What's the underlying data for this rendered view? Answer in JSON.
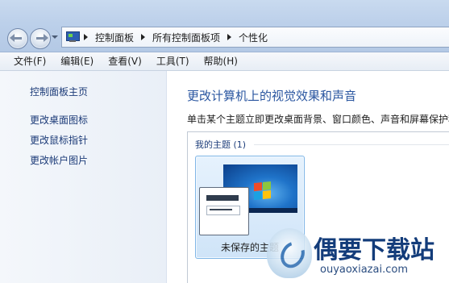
{
  "address": {
    "crumbs": [
      "控制面板",
      "所有控制面板项",
      "个性化"
    ]
  },
  "menu": {
    "items": [
      "文件(F)",
      "编辑(E)",
      "查看(V)",
      "工具(T)",
      "帮助(H)"
    ]
  },
  "sidebar": {
    "home": "控制面板主页",
    "links": [
      "更改桌面图标",
      "更改鼠标指针",
      "更改帐户图片"
    ]
  },
  "main": {
    "heading": "更改计算机上的视觉效果和声音",
    "subtext": "单击某个主题立即更改桌面背景、窗口颜色、声音和屏幕保护程序",
    "group_title": "我的主题 (1)",
    "theme_name": "未保存的主题"
  },
  "watermark": {
    "title": "偶要下载站",
    "url": "ouyaoxiazai.com"
  }
}
